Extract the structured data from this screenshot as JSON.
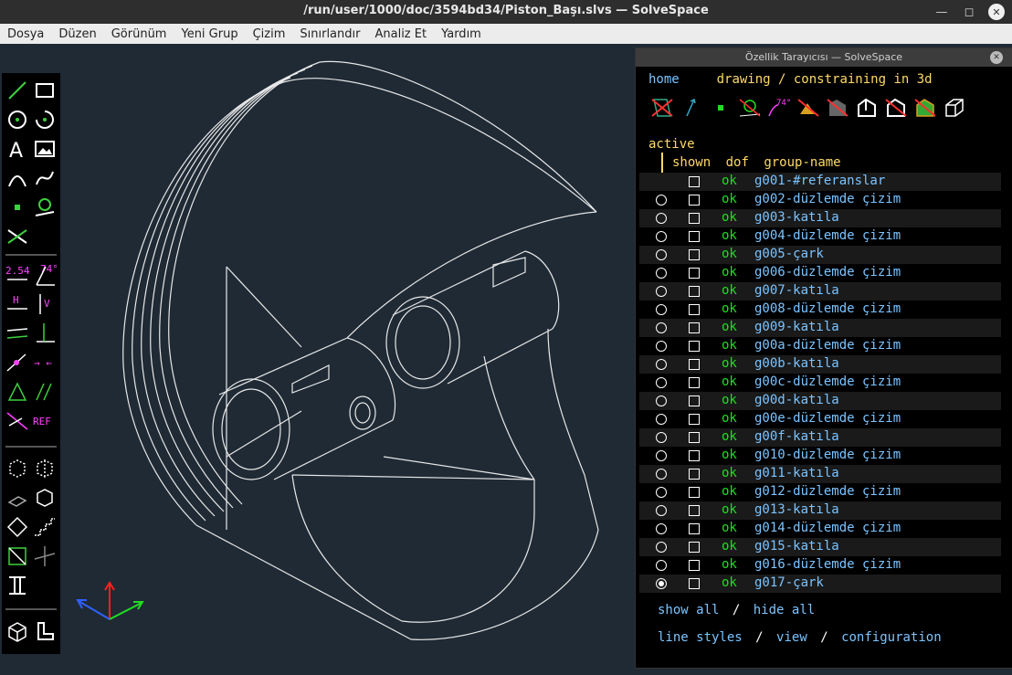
{
  "window": {
    "title": "/run/user/1000/doc/3594bd34/Piston_Başı.slvs — SolveSpace"
  },
  "menu": [
    "Dosya",
    "Düzen",
    "Görünüm",
    "Yeni Grup",
    "Çizim",
    "Sınırlandır",
    "Analiz Et",
    "Yardım"
  ],
  "toolbar": {
    "dim_label": "2.54",
    "angle_label": "74°",
    "ref_label": "REF"
  },
  "browser": {
    "title": "Özellik Tarayıcısı — SolveSpace",
    "home": "home",
    "mode": "drawing / constraining in 3d",
    "angle_icon_label": "74°",
    "active_label": "active",
    "col_shown": "shown",
    "col_dof": "dof",
    "col_name": "group-name",
    "groups": [
      {
        "name": "g001-#referanslar",
        "dof": "ok",
        "radio": "none"
      },
      {
        "name": "g002-düzlemde çizim",
        "dof": "ok",
        "radio": "off"
      },
      {
        "name": "g003-katıla",
        "dof": "ok",
        "radio": "off"
      },
      {
        "name": "g004-düzlemde çizim",
        "dof": "ok",
        "radio": "off"
      },
      {
        "name": "g005-çark",
        "dof": "ok",
        "radio": "off"
      },
      {
        "name": "g006-düzlemde çizim",
        "dof": "ok",
        "radio": "off"
      },
      {
        "name": "g007-katıla",
        "dof": "ok",
        "radio": "off"
      },
      {
        "name": "g008-düzlemde çizim",
        "dof": "ok",
        "radio": "off"
      },
      {
        "name": "g009-katıla",
        "dof": "ok",
        "radio": "off"
      },
      {
        "name": "g00a-düzlemde çizim",
        "dof": "ok",
        "radio": "off"
      },
      {
        "name": "g00b-katıla",
        "dof": "ok",
        "radio": "off"
      },
      {
        "name": "g00c-düzlemde çizim",
        "dof": "ok",
        "radio": "off"
      },
      {
        "name": "g00d-katıla",
        "dof": "ok",
        "radio": "off"
      },
      {
        "name": "g00e-düzlemde çizim",
        "dof": "ok",
        "radio": "off"
      },
      {
        "name": "g00f-katıla",
        "dof": "ok",
        "radio": "off"
      },
      {
        "name": "g010-düzlemde çizim",
        "dof": "ok",
        "radio": "off"
      },
      {
        "name": "g011-katıla",
        "dof": "ok",
        "radio": "off"
      },
      {
        "name": "g012-düzlemde çizim",
        "dof": "ok",
        "radio": "off"
      },
      {
        "name": "g013-katıla",
        "dof": "ok",
        "radio": "off"
      },
      {
        "name": "g014-düzlemde çizim",
        "dof": "ok",
        "radio": "off"
      },
      {
        "name": "g015-katıla",
        "dof": "ok",
        "radio": "off"
      },
      {
        "name": "g016-düzlemde çizim",
        "dof": "ok",
        "radio": "off"
      },
      {
        "name": "g017-çark",
        "dof": "ok",
        "radio": "on"
      }
    ],
    "show_all": "show all",
    "hide_all": "hide all",
    "line_styles": "line styles",
    "view": "view",
    "configuration": "configuration",
    "sep": "/"
  },
  "colors": {
    "background": "#1f2a35",
    "link": "#7cc4ff",
    "ok": "#22dd22",
    "heading": "#ffd966",
    "constraint": "#ff40ff"
  }
}
